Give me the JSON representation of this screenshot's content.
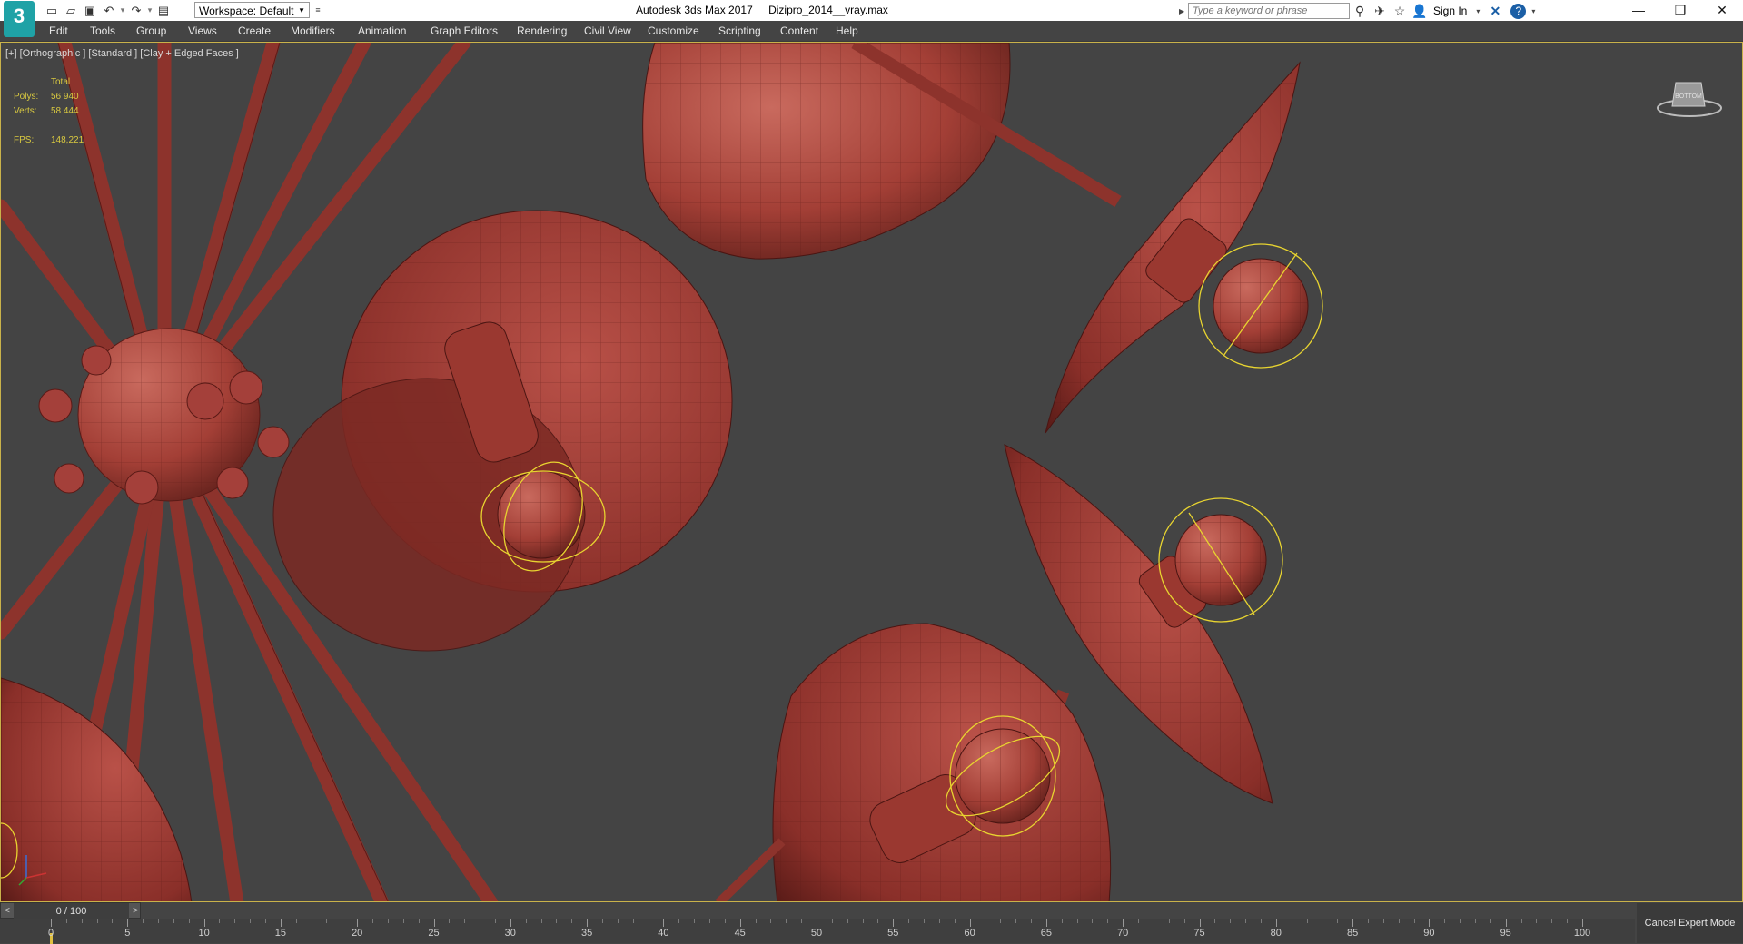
{
  "app": {
    "logo_text": "3",
    "title": "Autodesk 3ds Max 2017",
    "file_name": "Dizipro_2014__vray.max"
  },
  "quick_access": {
    "workspace_label": "Workspace: Default",
    "tools": [
      "new-file-icon",
      "open-file-icon",
      "save-icon",
      "undo-icon",
      "redo-icon",
      "project-folder-icon"
    ]
  },
  "search": {
    "placeholder": "Type a keyword or phrase"
  },
  "header_right": {
    "sign_in_label": "Sign In",
    "help_glyph": "?"
  },
  "menu": [
    "Edit",
    "Tools",
    "Group",
    "Views",
    "Create",
    "Modifiers",
    "Animation",
    "Graph Editors",
    "Rendering",
    "Civil View",
    "Customize",
    "Scripting",
    "Content",
    "Help"
  ],
  "viewport": {
    "label": "[+] [Orthographic ] [Standard ] [Clay + Edged Faces ]",
    "stats": {
      "header": "Total",
      "polys_label": "Polys:",
      "polys_value": "56 940",
      "verts_label": "Verts:",
      "verts_value": "58 444",
      "fps_label": "FPS:",
      "fps_value": "148,221"
    },
    "viewcube_label": "BOTTOM",
    "model_color": "#b24a40",
    "selection_color": "#e8d430",
    "border_color": "#c9b24a"
  },
  "timeline": {
    "frame_display": "0 / 100",
    "prev_glyph": "<",
    "next_glyph": ">",
    "tick_labels": [
      "0",
      "5",
      "10",
      "15",
      "20",
      "25",
      "30",
      "35",
      "40",
      "45",
      "50",
      "55",
      "60",
      "65",
      "70",
      "75",
      "80",
      "85",
      "90",
      "95",
      "100"
    ],
    "current_frame": 0,
    "cancel_expert_label": "Cancel Expert Mode"
  }
}
